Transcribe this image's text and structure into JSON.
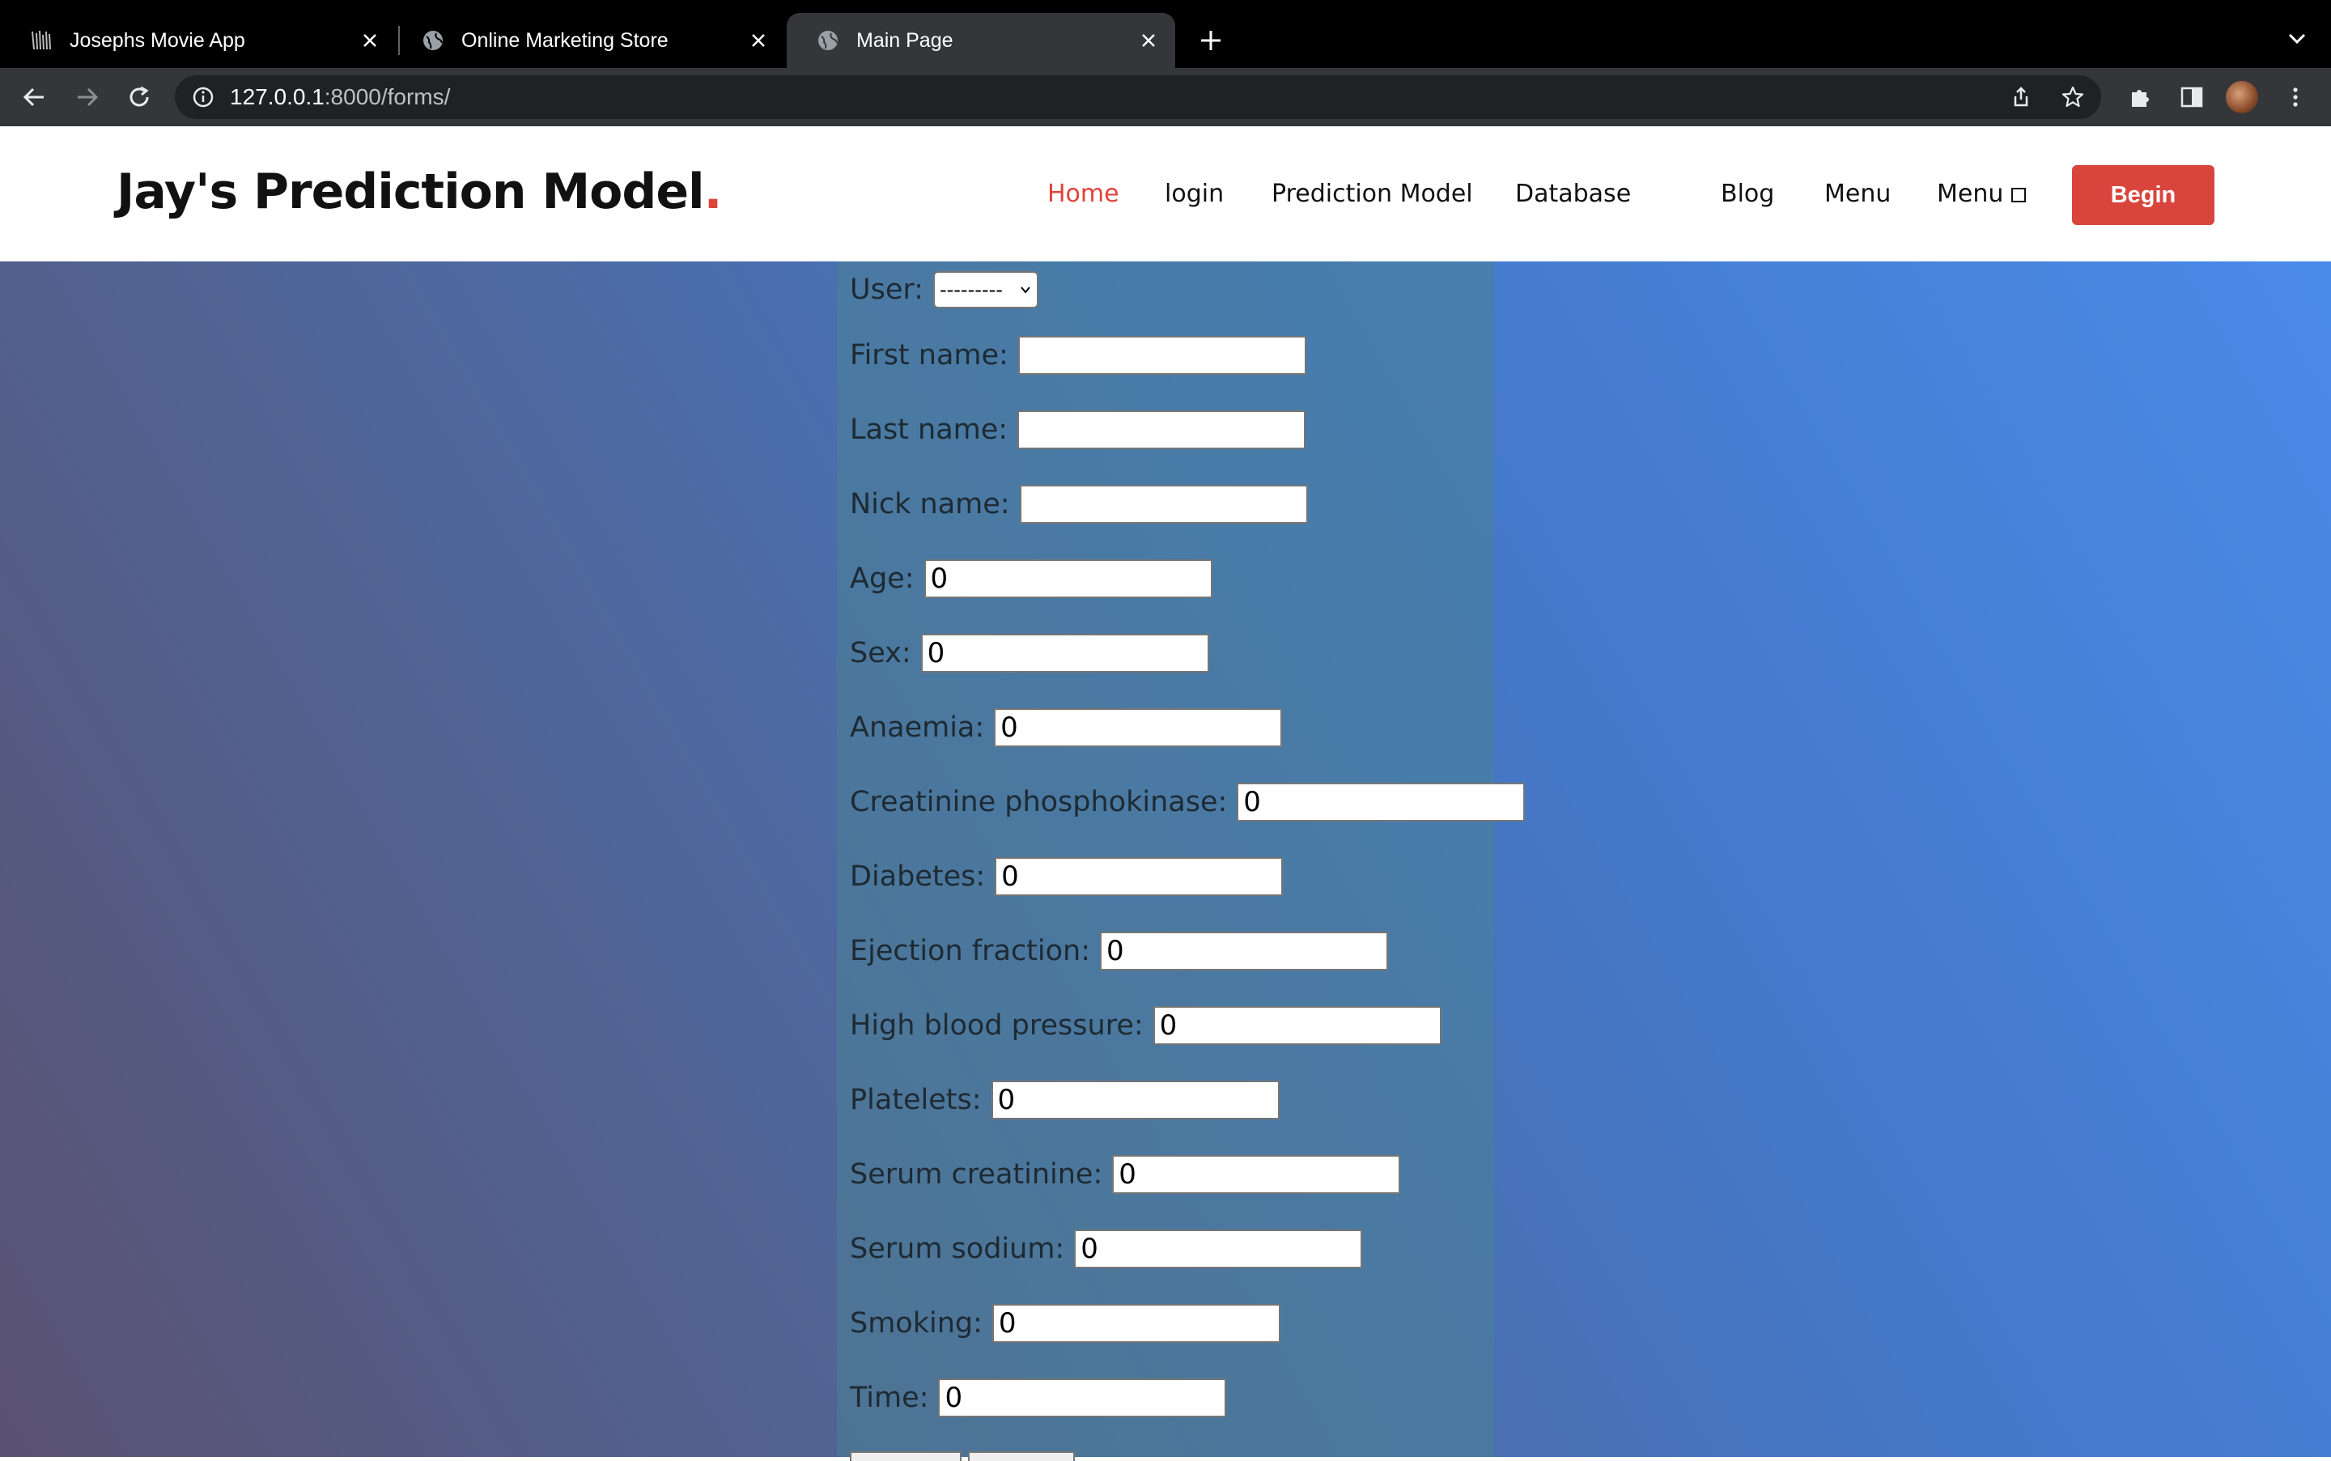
{
  "browser": {
    "tabs": [
      {
        "title": "Josephs Movie App",
        "icon": "movie-app-favicon",
        "active": false
      },
      {
        "title": "Online Marketing Store",
        "icon": "globe-icon",
        "active": false
      },
      {
        "title": "Main Page",
        "icon": "globe-icon",
        "active": true
      }
    ],
    "url_host": "127.0.0.1",
    "url_rest": ":8000/forms/"
  },
  "site": {
    "brand": "Jay's Prediction Model",
    "brand_dot": ".",
    "nav": [
      {
        "label": "Home",
        "active": true
      },
      {
        "label": "login"
      },
      {
        "label": "Prediction Model"
      },
      {
        "label": "Database"
      },
      {
        "label": "Blog"
      },
      {
        "label": "Menu"
      },
      {
        "label": "Menu"
      }
    ],
    "begin_label": "Begin",
    "accent_color": "#e0433a"
  },
  "form": {
    "user_label": "User:",
    "user_value": "---------",
    "fields": [
      {
        "label": "First name:",
        "value": ""
      },
      {
        "label": "Last name:",
        "value": ""
      },
      {
        "label": "Nick name:",
        "value": ""
      },
      {
        "label": "Age:",
        "value": "0"
      },
      {
        "label": "Sex:",
        "value": "0"
      },
      {
        "label": "Anaemia:",
        "value": "0"
      },
      {
        "label": "Creatinine phosphokinase:",
        "value": "0"
      },
      {
        "label": "Diabetes:",
        "value": "0"
      },
      {
        "label": "Ejection fraction:",
        "value": "0"
      },
      {
        "label": "High blood pressure:",
        "value": "0"
      },
      {
        "label": "Platelets:",
        "value": "0"
      },
      {
        "label": "Serum creatinine:",
        "value": "0"
      },
      {
        "label": "Serum sodium:",
        "value": "0"
      },
      {
        "label": "Smoking:",
        "value": "0"
      },
      {
        "label": "Time:",
        "value": "0"
      }
    ]
  }
}
